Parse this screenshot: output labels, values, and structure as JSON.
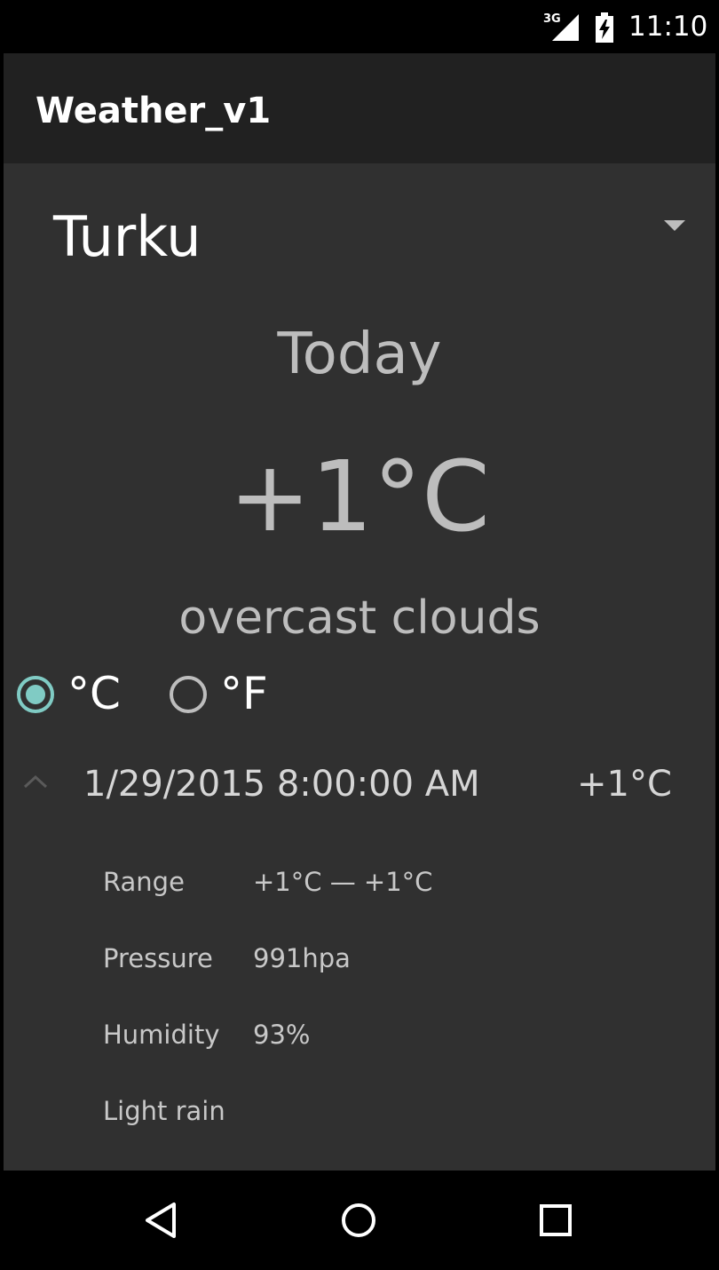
{
  "status_bar": {
    "network_label": "3G",
    "time": "11:10",
    "icons": [
      "signal-icon",
      "battery-icon"
    ]
  },
  "app": {
    "title": "Weather_v1"
  },
  "city_spinner": {
    "selected": "Turku",
    "icon": "dropdown-arrow-icon"
  },
  "today": {
    "label": "Today",
    "temperature": "+1°C",
    "condition": "overcast clouds"
  },
  "units": {
    "options": [
      {
        "label": "°C",
        "selected": true
      },
      {
        "label": "°F",
        "selected": false
      }
    ],
    "accent_color": "#80cbc4"
  },
  "forecast": {
    "expanded": true,
    "date": "1/29/2015 8:00:00 AM",
    "temperature": "+1°C",
    "details": [
      {
        "label": "Range",
        "value": "+1°C — +1°C"
      },
      {
        "label": "Pressure",
        "value": "991hpa"
      },
      {
        "label": "Humidity",
        "value": "93%"
      },
      {
        "label": "Light rain",
        "value": ""
      }
    ]
  },
  "nav_bar": {
    "icons": [
      "back-icon",
      "home-icon",
      "recent-apps-icon"
    ]
  },
  "colors": {
    "background": "#303030",
    "app_bar": "#212121",
    "status_bar": "#000000",
    "text_secondary": "#bdbdbd"
  }
}
